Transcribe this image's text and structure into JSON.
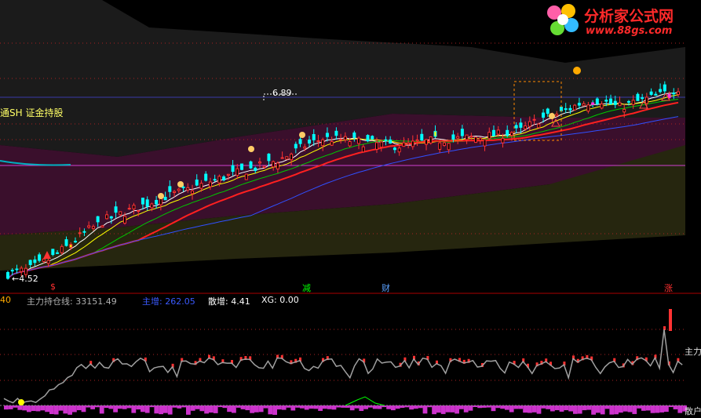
{
  "logo": {
    "name": "分析家公式网",
    "url": "www.88gs.com"
  },
  "main_panel": {
    "index_label": "通SH 证金持股",
    "price_high_label": "6.89",
    "price_low_label": "←4.52",
    "signals": [
      {
        "label": "$",
        "color": "#ff3030"
      },
      {
        "label": "减",
        "color": "#00ff00"
      },
      {
        "label": "财",
        "color": "#5aa0ff"
      },
      {
        "label": "涨",
        "color": "#ff3030"
      }
    ]
  },
  "sub_panel": {
    "left_value": "40",
    "holding_line": "主力持仓线: 33151.49",
    "main_increase": "主增: 262.05",
    "retail_increase": "散增: 4.41",
    "xg": "XG: 0.00",
    "right_label_main": "主力",
    "right_label_retail": "散户"
  },
  "colors": {
    "up": "#ff3232",
    "down": "#00ffff",
    "ma_white": "#ffffff",
    "ma_yellow": "#ffff00",
    "ma_red": "#ff2020",
    "ma_blue": "#3050ff",
    "ma_green": "#00c800",
    "band_magenta": "#3a0f2c",
    "band_olive": "#26260f",
    "band_gray": "#1b1b1b",
    "sub_line": "#a0a0a0",
    "sub_bar": "#cc33cc",
    "guide_magenta": "#d040d0",
    "guide_cyan": "#00b0c0"
  },
  "chart_data": {
    "type": "candlestick",
    "title": "通SH 证金持股",
    "price_range": [
      4.52,
      6.89
    ],
    "annotated_high": 6.89,
    "annotated_low": 4.52,
    "candle_count": 150,
    "close_path": [
      4.55,
      4.6,
      4.72,
      4.9,
      5.1,
      5.25,
      5.35,
      5.45,
      5.55,
      5.62,
      5.72,
      5.8,
      5.88,
      5.95,
      6.05,
      6.2,
      6.3,
      6.28,
      6.25,
      6.22,
      6.2,
      6.25,
      6.28,
      6.3,
      6.32,
      6.35,
      6.4,
      6.55,
      6.62,
      6.75,
      6.8,
      6.7,
      6.78,
      6.85,
      6.95
    ],
    "sub_series": {
      "holding_line_end": 33151.49,
      "main_increase": 262.05,
      "retail_increase": 4.41,
      "xg": 0
    }
  }
}
